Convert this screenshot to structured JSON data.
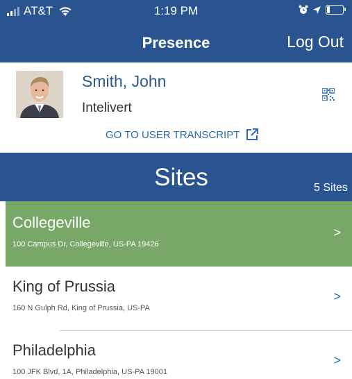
{
  "status_bar": {
    "carrier": "AT&T",
    "time": "1:19 PM"
  },
  "nav": {
    "title": "Presence",
    "logout_label": "Log Out"
  },
  "profile": {
    "name": "Smith, John",
    "company": "Intelivert",
    "transcript_link": "GO TO USER TRANSCRIPT"
  },
  "sites": {
    "title": "Sites",
    "count": "5 Sites",
    "items": [
      {
        "name": "Collegeville",
        "address": "100 Campus Dr, Collegeville, US-PA 19426",
        "chevron": ">"
      },
      {
        "name": "King of Prussia",
        "address": "160 N Gulph Rd, King of Prussia, US-PA",
        "chevron": ">"
      },
      {
        "name": "Philadelphia",
        "address": "100 JFK Blvd, 1A, Philadelphia, US-PA 19001",
        "chevron": ">"
      }
    ]
  },
  "colors": {
    "header_blue": "#2a5490",
    "selected_green": "#78a868",
    "link_blue": "#2a6cb3"
  }
}
